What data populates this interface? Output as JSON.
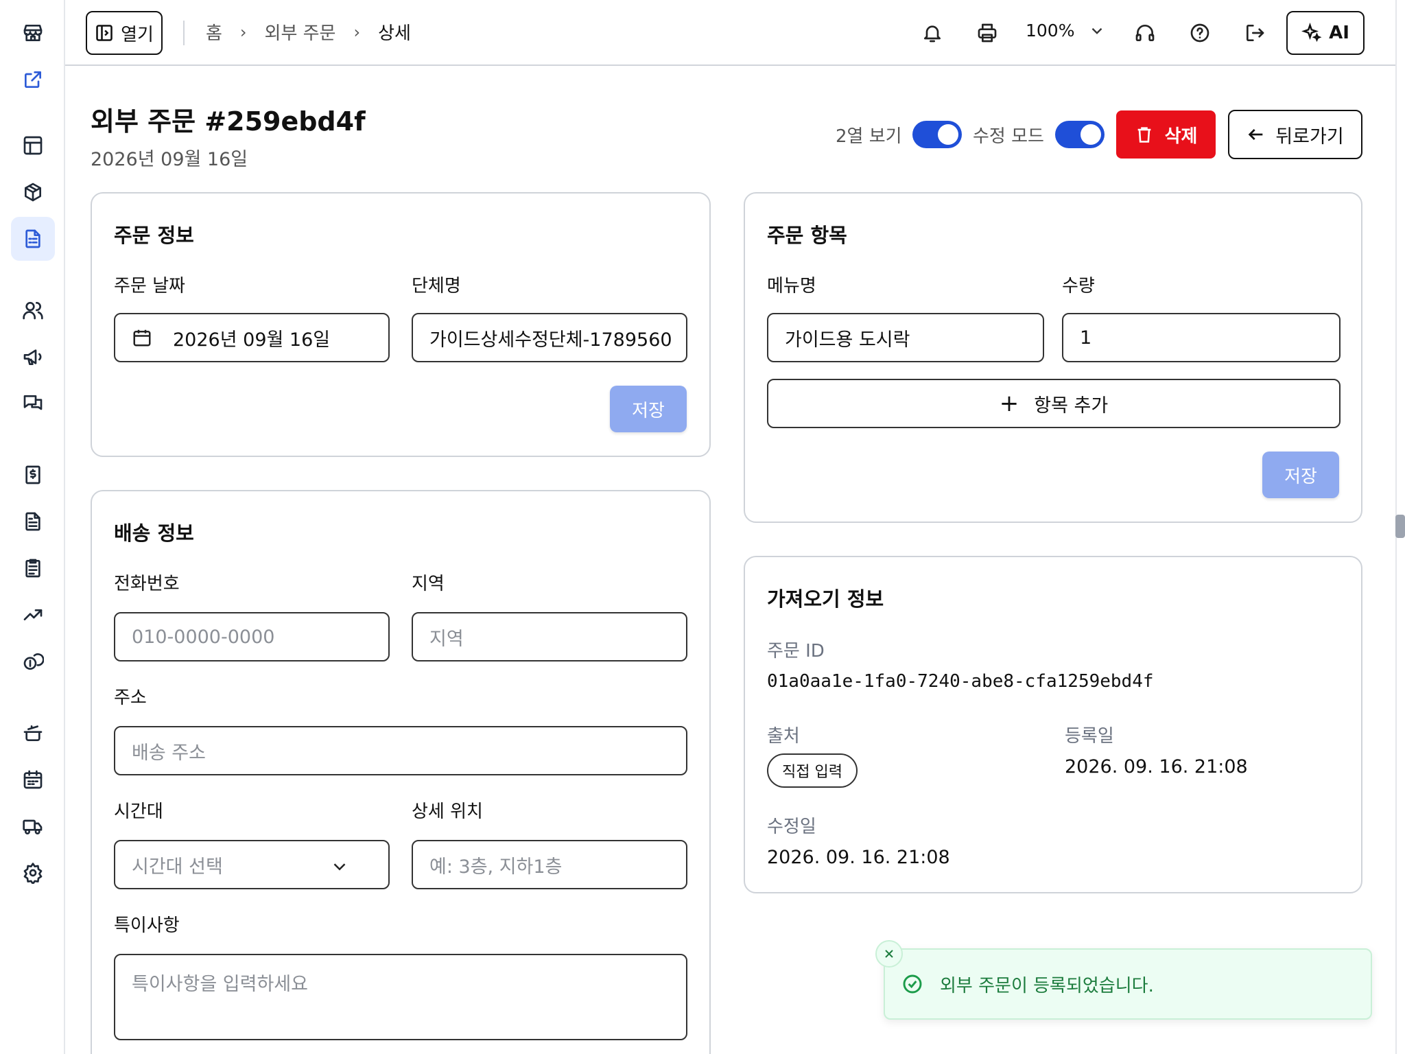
{
  "topbar": {
    "open_label": "열기",
    "breadcrumb": [
      "홈",
      "외부 주문",
      "상세"
    ],
    "zoom": "100%",
    "ai_label": "AI"
  },
  "page": {
    "title": "외부 주문 #259ebd4f",
    "date": "2026년 09월 16일",
    "two_col_label": "2열 보기",
    "edit_mode_label": "수정 모드",
    "delete_label": "삭제",
    "back_label": "뒤로가기"
  },
  "order_info": {
    "title": "주문 정보",
    "date_label": "주문 날짜",
    "date_value": "2026년 09월 16일",
    "group_label": "단체명",
    "group_value": "가이드상세수정단체-1789560",
    "save_label": "저장"
  },
  "order_items": {
    "title": "주문 항목",
    "menu_label": "메뉴명",
    "qty_label": "수량",
    "menu_value": "가이드용 도시락",
    "qty_value": "1",
    "add_label": "항목 추가",
    "save_label": "저장"
  },
  "delivery": {
    "title": "배송 정보",
    "phone_label": "전화번호",
    "phone_placeholder": "010-0000-0000",
    "region_label": "지역",
    "region_placeholder": "지역",
    "address_label": "주소",
    "address_placeholder": "배송 주소",
    "time_label": "시간대",
    "time_placeholder": "시간대 선택",
    "location_label": "상세 위치",
    "location_placeholder": "예: 3층, 지하1층",
    "notes_label": "특이사항",
    "notes_placeholder": "특이사항을 입력하세요"
  },
  "import_info": {
    "title": "가져오기 정보",
    "order_id_label": "주문 ID",
    "order_id": "01a0aa1e-1fa0-7240-abe8-cfa1259ebd4f",
    "source_label": "출처",
    "source_value": "직접 입력",
    "registered_label": "등록일",
    "registered_value": "2026. 09. 16. 21:08",
    "modified_label": "수정일",
    "modified_value": "2026. 09. 16. 21:08"
  },
  "toast": {
    "message": "외부 주문이 등록되었습니다."
  },
  "colors": {
    "accent": "#1f4fd8",
    "danger": "#e8101a",
    "save_disabled": "#8faaf0",
    "toast_bg": "#ecfdf3"
  },
  "sidebar_icons": [
    "store-icon",
    "external-link-icon",
    "table-icon",
    "package-icon",
    "document-list-icon",
    "users-icon",
    "megaphone-icon",
    "chat-icon",
    "receipt-dollar-icon",
    "file-text-icon",
    "clipboard-list-icon",
    "trending-up-icon",
    "coins-icon",
    "cooking-pot-icon",
    "calendar-icon",
    "truck-icon",
    "settings-icon"
  ]
}
